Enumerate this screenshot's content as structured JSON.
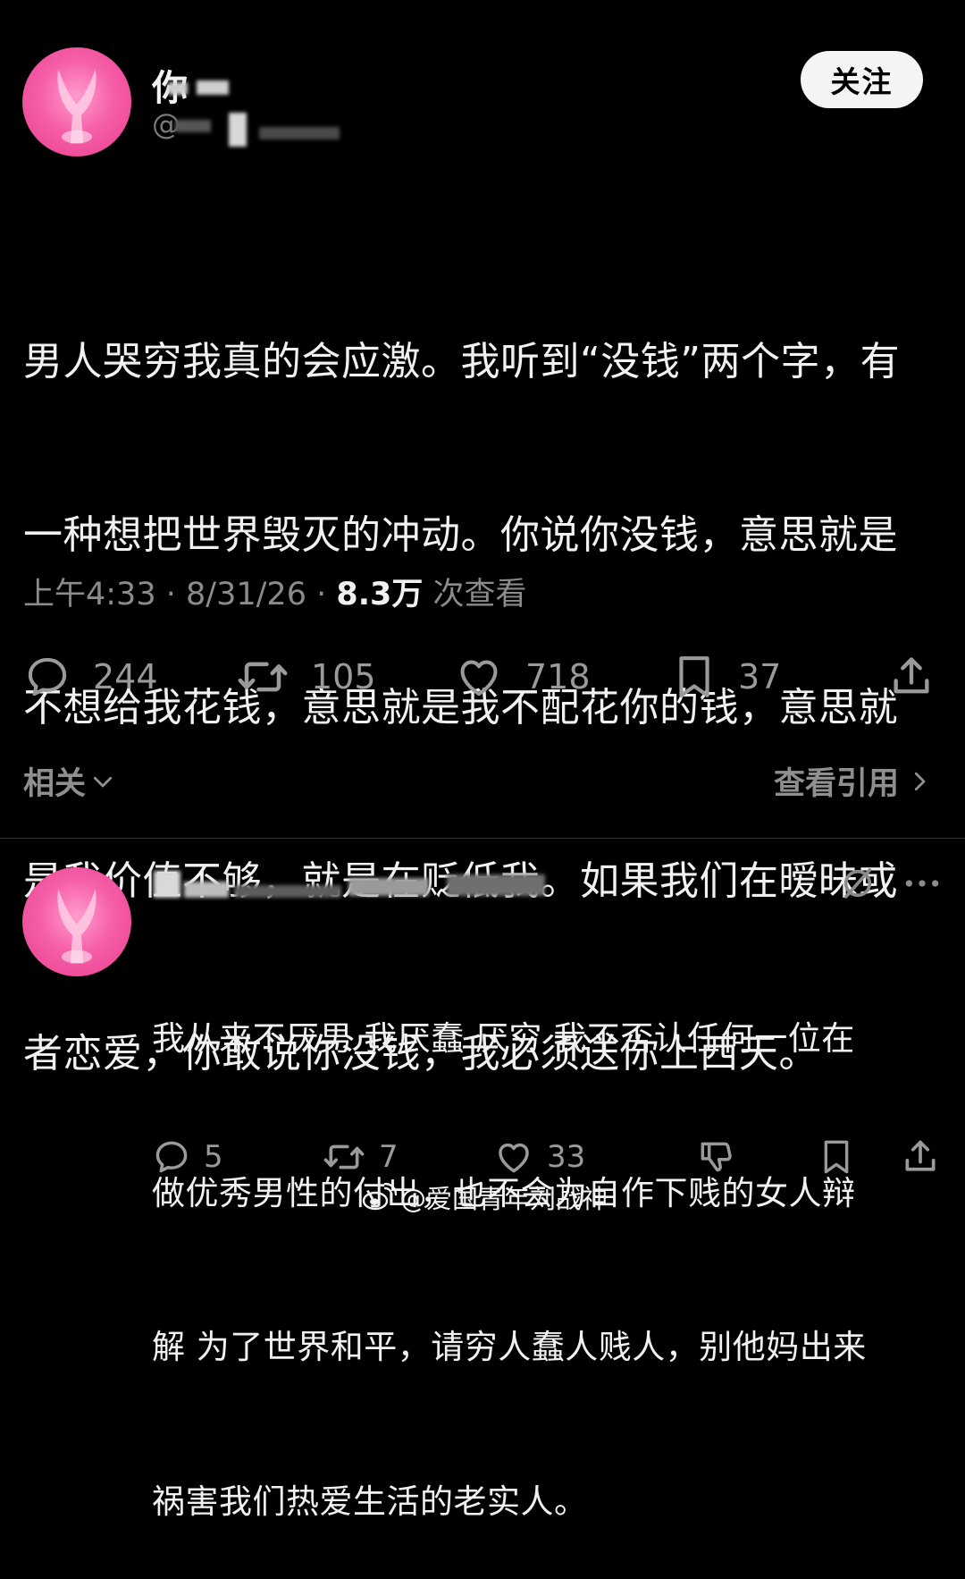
{
  "post": {
    "author_name_visible": "你",
    "author_handle_prefix": "@",
    "follow_label": "关注",
    "lines": [
      "男人哭穷我真的会应激。我听到“没钱”两个字，有",
      "一种想把世界毁灭的冲动。你说你没钱，意思就是",
      "不想给我花钱，意思就是我不配花你的钱，意思就",
      "是我价值不够，就是在贬低我。如果我们在暧昧或",
      "者恋爱，你敢说你没钱，我必须送你上西天。"
    ],
    "time": "上午4:33",
    "date": "8/31/26",
    "views_count": "8.3万",
    "views_label": "次查看",
    "separator": "·",
    "stats": {
      "replies": "244",
      "reposts": "105",
      "likes": "718",
      "bookmarks": "37"
    },
    "related_label": "相关",
    "view_quotes_label": "查看引用"
  },
  "reply": {
    "lines": [
      "我从来不厌男 我厌蠢 厌穷 我不否认任何一位在",
      "做优秀男性的付出，也不会为自作下贱的女人辩",
      "解 为了世界和平，请穷人蠢人贱人，别他妈出来",
      "祸害我们热爱生活的老实人。"
    ],
    "stats": {
      "replies": "5",
      "reposts": "7",
      "likes": "33"
    }
  },
  "watermark": {
    "text": "@爱国青年刘战神"
  },
  "icons": {
    "reply": "reply-icon",
    "repost": "repost-icon",
    "like": "heart-icon",
    "bookmark": "bookmark-icon",
    "share": "share-icon",
    "dislike": "dislike-icon",
    "grok": "grok-icon",
    "more": "more-icon",
    "chevron_down": "chevron-down-icon",
    "chevron_right": "chevron-right-icon",
    "weibo": "weibo-icon"
  },
  "colors": {
    "background": "#000000",
    "avatar_pink": "#f65fa8",
    "secondary_text": "#8b8b8b",
    "follow_button": "#f4f4f4"
  }
}
